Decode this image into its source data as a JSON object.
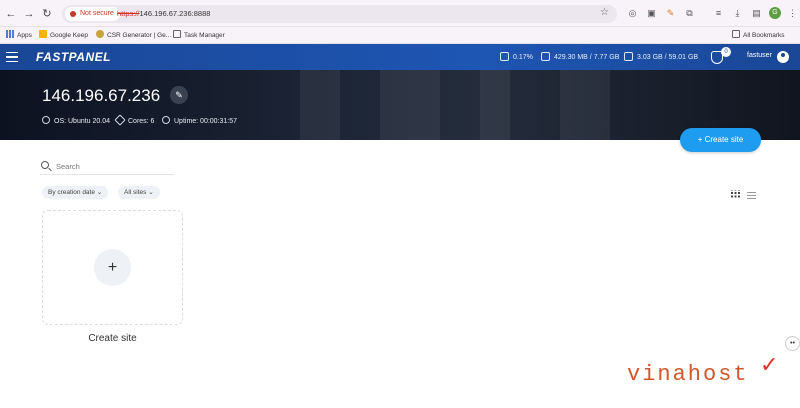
{
  "browser": {
    "not_secure": "Not secure",
    "url_scheme": "https://",
    "url_host": "146.196.67.236:8888",
    "bookmarks": [
      "Apps",
      "Google Keep",
      "CSR Generator | Ge...",
      "Task Manager"
    ],
    "all_bookmarks": "All Bookmarks",
    "profile_initial": "G"
  },
  "app": {
    "logo": "FASTPANEL",
    "stats": {
      "cpu": "0.17%",
      "ram": "429.30 MB / 7.77 GB",
      "disk": "3.03 GB / 59.01 GB"
    },
    "notification_count": "0",
    "username": "fastuser"
  },
  "server": {
    "title": "146.196.67.236",
    "os": "OS: Ubuntu 20.04",
    "cores": "Cores: 6",
    "uptime": "Uptime: 00:00:31:57"
  },
  "toolbar": {
    "create_site": "Create site",
    "search_placeholder": "Search",
    "sort": "By creation date",
    "filter": "All sites"
  },
  "card": {
    "plus": "+",
    "label": "Create site"
  },
  "watermark": {
    "brand": "vinahost",
    "mark": "✓"
  },
  "colors": {
    "header": "#1e56b4",
    "accent": "#1e9cf0",
    "brand": "#d2582a"
  }
}
